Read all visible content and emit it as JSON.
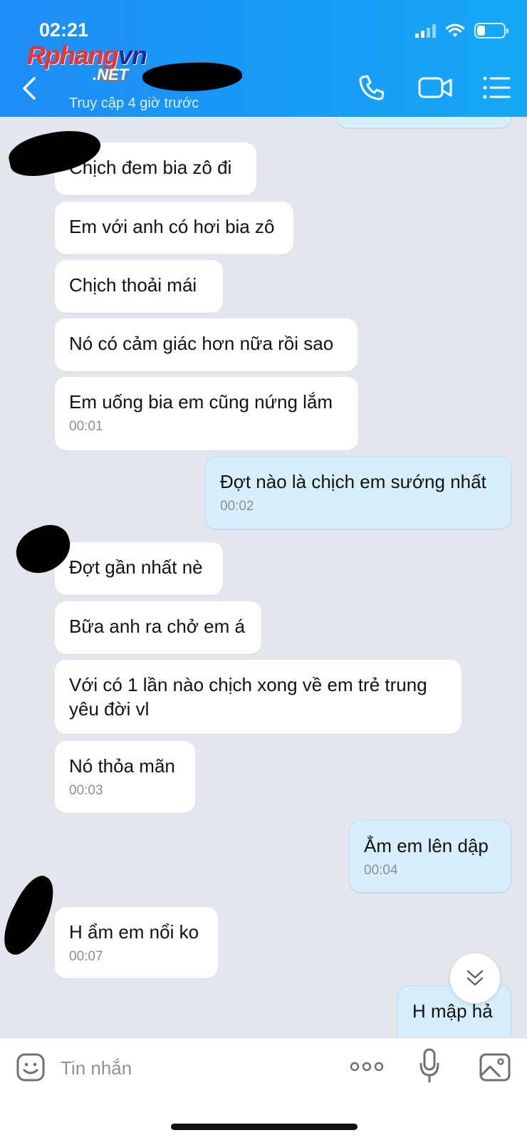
{
  "status": {
    "time": "02:21"
  },
  "header": {
    "logo_main": "Rphang",
    "logo_vn": "vn",
    "logo_net": ".NET",
    "subtitle": "Truy cập 4 giờ trước"
  },
  "messages": [
    {
      "dir": "in",
      "text": "Chịch đem bia zô đi",
      "time": ""
    },
    {
      "dir": "in",
      "text": "Em với anh có hơi bia zô",
      "time": ""
    },
    {
      "dir": "in",
      "text": "Chịch thoải mái",
      "time": ""
    },
    {
      "dir": "in",
      "text": "Nó có cảm giác hơn nữa rồi sao",
      "time": ""
    },
    {
      "dir": "in",
      "text": "Em uống bia em cũng nứng lắm",
      "time": "00:01"
    },
    {
      "dir": "out",
      "text": "Đợt nào là chịch em sướng nhất",
      "time": "00:02"
    },
    {
      "dir": "in",
      "text": "Đợt gần nhất nè",
      "time": ""
    },
    {
      "dir": "in",
      "text": "Bữa anh ra chở em á",
      "time": ""
    },
    {
      "dir": "in",
      "text": "Với có 1 lần nào chịch xong về em trẻ trung yêu đời vl",
      "time": ""
    },
    {
      "dir": "in",
      "text": "Nó thỏa mãn",
      "time": "00:03"
    },
    {
      "dir": "out",
      "text": "Ẳm em lên dập",
      "time": "00:04"
    },
    {
      "dir": "in",
      "text": "H ẩm em nổi ko",
      "time": "00:07"
    },
    {
      "dir": "out",
      "text": "H mập hả",
      "time": ""
    }
  ],
  "composer": {
    "placeholder": "Tin nhắn"
  },
  "icons": {
    "back": "chevron-left-icon",
    "call": "phone-icon",
    "video": "video-camera-icon",
    "menu": "list-menu-icon",
    "emoji": "sticker-emoji-icon",
    "more": "more-dots-icon",
    "mic": "microphone-icon",
    "gallery": "image-gallery-icon",
    "scroll": "double-chevron-down-icon"
  }
}
